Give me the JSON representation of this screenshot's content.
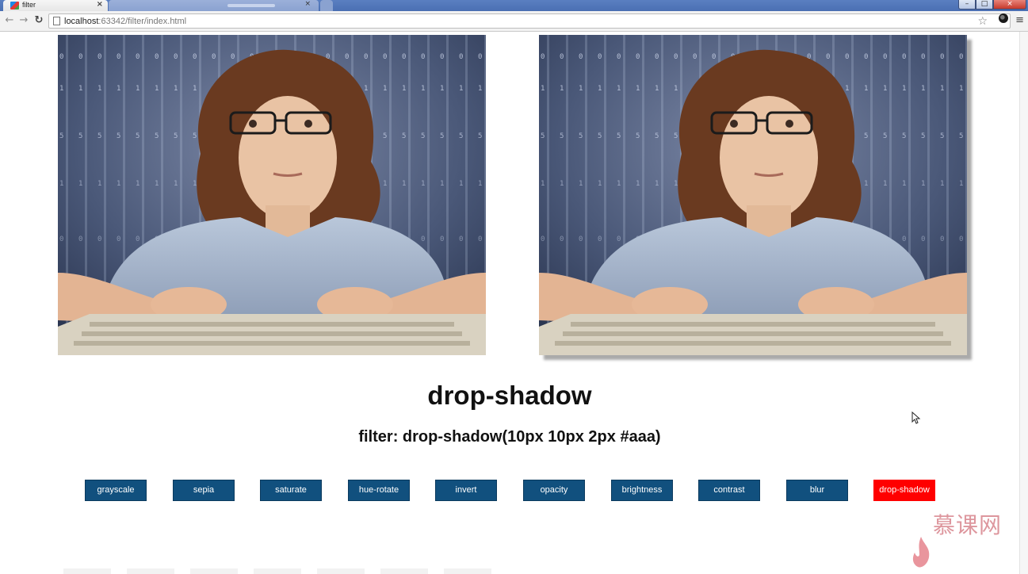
{
  "browser": {
    "tab_title": "filter",
    "tab_close": "×",
    "url_host": "localhost",
    "url_rest": ":63342/filter/index.html",
    "controls": {
      "minimize": "–",
      "maximize": "□",
      "close": "×"
    }
  },
  "page": {
    "effect_title": "drop-shadow",
    "filter_caption": "filter: drop-shadow(10px 10px 2px #aaa)",
    "buttons": [
      {
        "label": "grayscale",
        "active": false
      },
      {
        "label": "sepia",
        "active": false
      },
      {
        "label": "saturate",
        "active": false
      },
      {
        "label": "hue-rotate",
        "active": false
      },
      {
        "label": "invert",
        "active": false
      },
      {
        "label": "opacity",
        "active": false
      },
      {
        "label": "brightness",
        "active": false
      },
      {
        "label": "contrast",
        "active": false
      },
      {
        "label": "blur",
        "active": false
      },
      {
        "label": "drop-shadow",
        "active": true
      }
    ],
    "active_color": "#ff0000",
    "button_color": "#11507e"
  },
  "watermark": {
    "text": "慕课网"
  },
  "icons": [
    "back-icon",
    "forward-icon",
    "reload-icon",
    "page-icon",
    "bookmark-star-icon",
    "extension-icon",
    "menu-icon",
    "cursor-icon",
    "flame-logo-icon"
  ]
}
